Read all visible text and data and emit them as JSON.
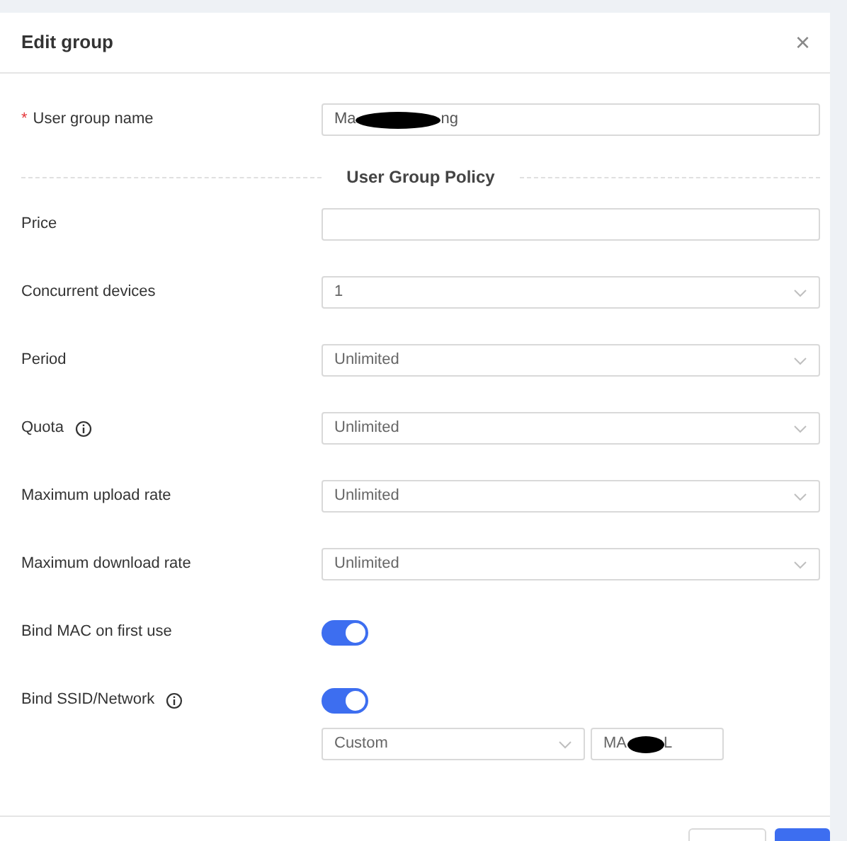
{
  "dialog": {
    "title": "Edit group",
    "close_glyph": "×"
  },
  "name_field": {
    "required_mark": "*",
    "label": "User group name",
    "value_start": "Ma",
    "value_end": "ng",
    "redacted": true
  },
  "section_title": "User Group Policy",
  "rows": [
    {
      "kind": "text",
      "label": "Price",
      "info": false
    },
    {
      "kind": "select",
      "label": "Concurrent devices",
      "value": "1",
      "info": false
    },
    {
      "kind": "select",
      "label": "Period",
      "value": "Unlimited",
      "info": false
    },
    {
      "kind": "select",
      "label": "Quota",
      "value": "Unlimited",
      "info": true
    },
    {
      "kind": "select",
      "label": "Maximum upload rate",
      "value": "Unlimited",
      "info": false
    },
    {
      "kind": "select",
      "label": "Maximum download rate",
      "value": "Unlimited",
      "info": false
    },
    {
      "kind": "switch",
      "label": "Bind MAC on first use",
      "on": true,
      "info": false
    },
    {
      "kind": "switch",
      "label": "Bind SSID/Network",
      "on": true,
      "info": true
    }
  ],
  "ssid": {
    "mode": "Custom",
    "value_start": "MA",
    "value_end": "L",
    "redacted": true
  }
}
